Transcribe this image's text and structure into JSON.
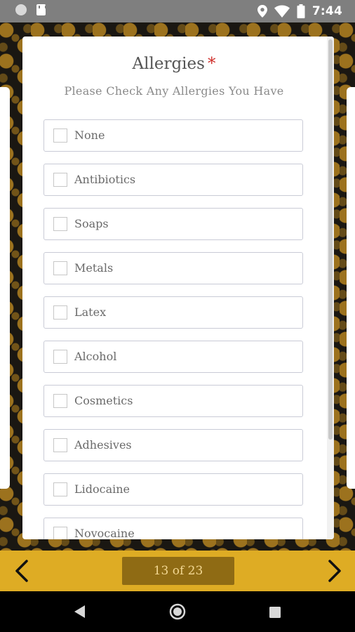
{
  "status_bar": {
    "time": "7:44",
    "icons": [
      "notification-dot-icon",
      "sd-card-icon",
      "location-icon",
      "wifi-icon",
      "battery-icon"
    ]
  },
  "form": {
    "title": "Allergies",
    "required_marker": "*",
    "subtitle": "Please Check Any Allergies You Have",
    "options": [
      {
        "label": "None",
        "checked": false
      },
      {
        "label": "Antibiotics",
        "checked": false
      },
      {
        "label": "Soaps",
        "checked": false
      },
      {
        "label": "Metals",
        "checked": false
      },
      {
        "label": "Latex",
        "checked": false
      },
      {
        "label": "Alcohol",
        "checked": false
      },
      {
        "label": "Cosmetics",
        "checked": false
      },
      {
        "label": "Adhesives",
        "checked": false
      },
      {
        "label": "Lidocaine",
        "checked": false
      },
      {
        "label": "Novocaine",
        "checked": false
      }
    ]
  },
  "navigation": {
    "page_indicator": "13 of 23",
    "prev_icon": "chevron-left-icon",
    "next_icon": "chevron-right-icon"
  },
  "colors": {
    "accent": "#deac24",
    "page_indicator_bg": "#8f6b14",
    "required": "#d0312d"
  }
}
